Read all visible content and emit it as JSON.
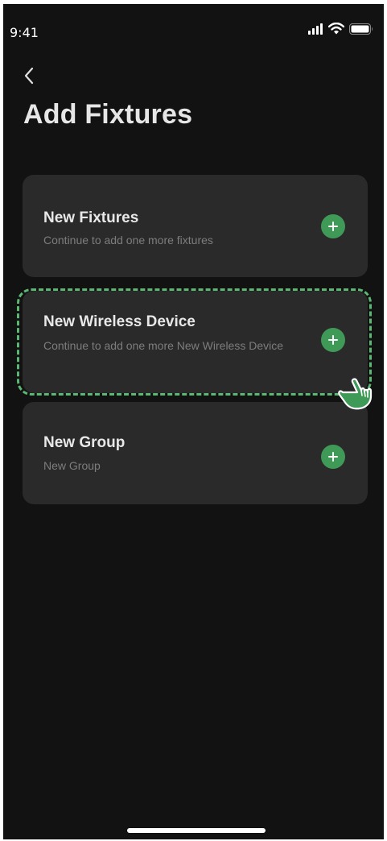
{
  "status_bar": {
    "time": "9:41",
    "icons": [
      "signal-icon",
      "wifi-icon",
      "battery-icon"
    ]
  },
  "header": {
    "back_icon": "chevron-left-icon",
    "title": "Add Fixtures"
  },
  "options": [
    {
      "title": "New Fixtures",
      "subtitle": "Continue to add one more fixtures",
      "action_icon": "plus-circle-icon"
    },
    {
      "title": "New Wireless Device",
      "subtitle": "Continue to add one more New Wireless Device",
      "action_icon": "plus-circle-icon",
      "highlighted": true
    },
    {
      "title": "New Group",
      "subtitle": "New Group",
      "action_icon": "plus-circle-icon"
    }
  ],
  "colors": {
    "background": "#121212",
    "card": "#2a2a2a",
    "accent": "#3f9a57",
    "highlight": "#5cb774"
  },
  "gesture_hint": "tap-hand-icon"
}
